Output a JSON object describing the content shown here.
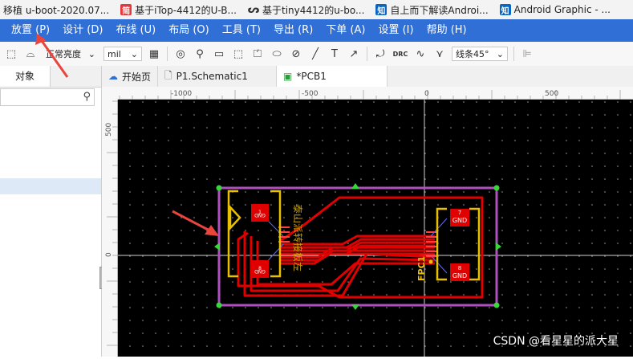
{
  "bookmarks": [
    {
      "label": "移植 u-boot-2020.07...",
      "icon": "page-icon",
      "color": "#8a8a8a"
    },
    {
      "label": "基于iTop-4412的U-B...",
      "icon": "csdn-icon",
      "color": "#e4393c"
    },
    {
      "label": "基于tiny4412的u-bo...",
      "icon": "yuque-icon",
      "color": "#333333"
    },
    {
      "label": "自上而下解读Androi...",
      "icon": "zhihu-icon",
      "color": "#0a66c2"
    },
    {
      "label": "Android Graphic - ...",
      "icon": "zhihu-icon",
      "color": "#0a66c2"
    }
  ],
  "menu": [
    "放置 (P)",
    "设计 (D)",
    "布线 (U)",
    "布局 (O)",
    "工具 (T)",
    "导出 (R)",
    "下单 (A)",
    "设置 (I)",
    "帮助 (H)"
  ],
  "toolbar": {
    "brightness": "正常亮度",
    "unit": "mil",
    "line_mode": "线条45°",
    "drc_label": "DRC"
  },
  "left_panel": {
    "tab_label": "对象",
    "search_placeholder": ""
  },
  "doc_tabs": [
    {
      "label": "开始页",
      "icon": "cloud-icon"
    },
    {
      "label": "P1.Schematic1",
      "icon": "document-icon"
    },
    {
      "label": "*PCB1",
      "icon": "pcb-icon"
    }
  ],
  "ruler": {
    "top_labels": [
      "-1000",
      "-500",
      "0",
      "500"
    ],
    "left_labels": [
      "500",
      "0"
    ]
  },
  "pcb": {
    "silk_text": "泰山派转接板左",
    "designator": "FPC1",
    "left_pads": [
      {
        "num": "1",
        "net": "GND"
      },
      {
        "num": "8",
        "net": "GND"
      }
    ],
    "right_pads": [
      {
        "num": "7",
        "net": "GND"
      },
      {
        "num": "8",
        "net": "GND"
      }
    ]
  },
  "watermark": "CSDN @看星星的派大星",
  "colors": {
    "menu_bg": "#2f6fd6",
    "canvas_bg": "#000000",
    "board_outline": "#b050c0",
    "trace": "#e00000",
    "silkscreen": "#e8c000",
    "annotation_arrow": "#e8453c"
  }
}
